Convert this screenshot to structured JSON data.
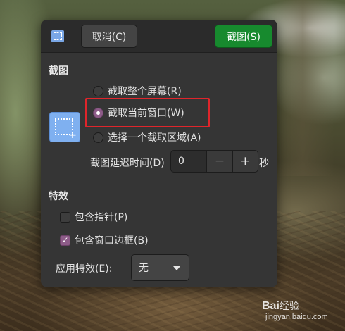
{
  "header": {
    "cancel_label": "取消(C)",
    "capture_label": "截图(S)"
  },
  "screenshot": {
    "title": "截图",
    "options": [
      {
        "label": "截取整个屏幕(R)",
        "selected": false
      },
      {
        "label": "截取当前窗口(W)",
        "selected": true
      },
      {
        "label": "选择一个截取区域(A)",
        "selected": false
      }
    ],
    "delay_label": "截图延迟时间(D)",
    "delay_value": "0",
    "delay_unit": "秒",
    "minus_symbol": "−",
    "plus_symbol": "+"
  },
  "effects": {
    "title": "特效",
    "include_pointer_label": "包含指针(P)",
    "include_pointer_checked": false,
    "include_border_label": "包含窗口边框(B)",
    "include_border_checked": true,
    "apply_effect_label": "应用特效(E):",
    "apply_effect_value": "无"
  },
  "watermark": {
    "logo": "Bai",
    "logo_suffix": "经验",
    "url": "jingyan.baidu.com"
  },
  "colors": {
    "accent_green": "#178a2e",
    "check_purple": "#8d5c88",
    "highlight_red": "#e0252b",
    "dialog_bg": "#353535"
  }
}
